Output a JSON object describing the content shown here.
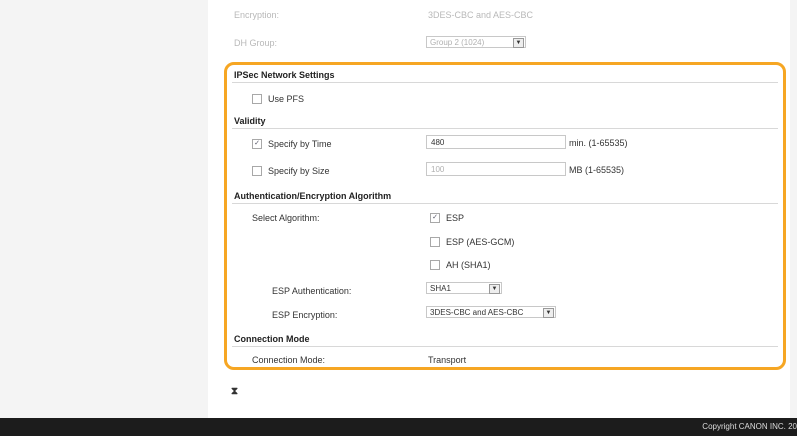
{
  "top": {
    "encryption_label": "Encryption:",
    "encryption_value": "3DES-CBC and AES-CBC",
    "dh_group_label": "DH Group:",
    "dh_group_value": "Group 2 (1024)"
  },
  "ipsec": {
    "title": "IPSec Network Settings",
    "use_pfs_label": "Use PFS",
    "use_pfs_checked": false
  },
  "validity": {
    "title": "Validity",
    "by_time_label": "Specify by Time",
    "by_time_checked": true,
    "by_time_value": "480",
    "by_time_hint": "min. (1-65535)",
    "by_size_label": "Specify by Size",
    "by_size_checked": false,
    "by_size_value": "100",
    "by_size_hint": "MB (1-65535)"
  },
  "auth": {
    "title": "Authentication/Encryption Algorithm",
    "select_label": "Select Algorithm:",
    "options": [
      {
        "label": "ESP",
        "checked": true
      },
      {
        "label": "ESP (AES-GCM)",
        "checked": false
      },
      {
        "label": "AH (SHA1)",
        "checked": false
      }
    ],
    "esp_auth_label": "ESP Authentication:",
    "esp_auth_value": "SHA1",
    "esp_enc_label": "ESP Encryption:",
    "esp_enc_value": "3DES-CBC and AES-CBC"
  },
  "connection": {
    "title": "Connection Mode",
    "label": "Connection Mode:",
    "value": "Transport"
  },
  "footer": {
    "copyright": "Copyright CANON INC. 20"
  },
  "colors": {
    "highlight": "#f6a623",
    "footer_bg": "#1c1c1c"
  },
  "icons": {
    "collapse": "collapse-arrow-icon",
    "check": "check-icon",
    "dropdown": "dropdown-arrow-icon"
  }
}
